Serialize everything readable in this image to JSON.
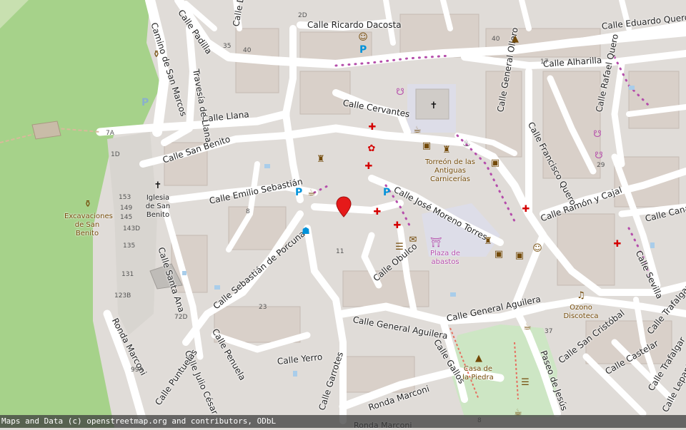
{
  "map": {
    "attribution": "Maps and Data (c) openstreetmap.org and contributors, ODbL",
    "colors": {
      "background": "#e0dcd8",
      "road": "#ffffff",
      "park": "#cde6c4",
      "grass": "#a6d28a",
      "plaza": "#dddde8",
      "poi_brown": "#734a08",
      "poi_purple": "#b54dab",
      "health": "#d40000",
      "parking": "#0092da"
    },
    "streets": [
      "Calle Ricardo Dacosta",
      "Calle Eduardo Quero",
      "Calle Alharilla",
      "Calle Cervantes",
      "Calle Llana",
      "Calle San Benito",
      "Calle Emilio Sebastián",
      "Calle José Moreno Torres",
      "Calle Ramón y Cajal",
      "Calle Canales",
      "Calle Sevilla",
      "Calle Sebastián de Porcuna",
      "Calle Santa Ana",
      "Calle Obulco",
      "Calle General Aguilera",
      "Calle General Aguilera",
      "Calle San Cristóbal",
      "Calle Castelar",
      "Calle Trafalgar",
      "Calle Penuela",
      "Calle Julio César",
      "Ronda Marconi",
      "Calle Yerro",
      "Calle Garrotes",
      "Calle Gallos",
      "Paseo de Jesús",
      "Ronda Marconi",
      "Camino de San Marcos",
      "Travesía de Llana",
      "Calle Padilla",
      "Calle Dacosta",
      "Calle General Ollero",
      "Calle Francisco Quero",
      "Calle Rafael Quero",
      "Calle Lepanto",
      "Calle Trafalgar",
      "Calle Puntuelas",
      "Ronda Marconi"
    ],
    "pois": [
      {
        "name": "Excavaciones de San Benito",
        "icon": "amphora-icon"
      },
      {
        "name": "Iglesia de San Benito",
        "icon": "church-icon"
      },
      {
        "name": "Torreón de las Antiguas Carnicerías",
        "icon": "castle-icon"
      },
      {
        "name": "Plaza de abastos",
        "icon": "market-icon"
      },
      {
        "name": "Ozono Discoteca",
        "icon": "music-icon"
      },
      {
        "name": "Casa de la Piedra",
        "icon": "monument-icon"
      }
    ],
    "house_numbers": [
      "2D",
      "4",
      "35",
      "3",
      "40",
      "5",
      "5",
      "10",
      "15",
      "16",
      "17",
      "19",
      "20",
      "2",
      "9",
      "3",
      "1",
      "17",
      "13",
      "2A",
      "22",
      "7A",
      "5",
      "17",
      "1D",
      "50",
      "27",
      "153",
      "149",
      "145",
      "143D",
      "135",
      "131",
      "123B",
      "99A",
      "4",
      "6",
      "8",
      "12",
      "10",
      "14A",
      "11",
      "15",
      "7",
      "8",
      "19D",
      "7",
      "D",
      "6",
      "15",
      "6",
      "4",
      "11",
      "10C",
      "12",
      "9",
      "27",
      "22",
      "23",
      "16D",
      "29",
      "34",
      "21",
      "39",
      "72D",
      "80",
      "90",
      "95",
      "2A",
      "18",
      "43",
      "45",
      "47",
      "56",
      "20",
      "32D",
      "1",
      "2",
      "13",
      "14",
      "17",
      "20",
      "23",
      "28",
      "32",
      "31",
      "30",
      "40",
      "44",
      "46",
      "50",
      "54",
      "62",
      "72",
      "26",
      "18",
      "10",
      "17",
      "14D",
      "11",
      "21",
      "30",
      "2",
      "7",
      "29",
      "9",
      "37",
      "5D",
      "8",
      "1B",
      "7",
      "10A"
    ]
  }
}
